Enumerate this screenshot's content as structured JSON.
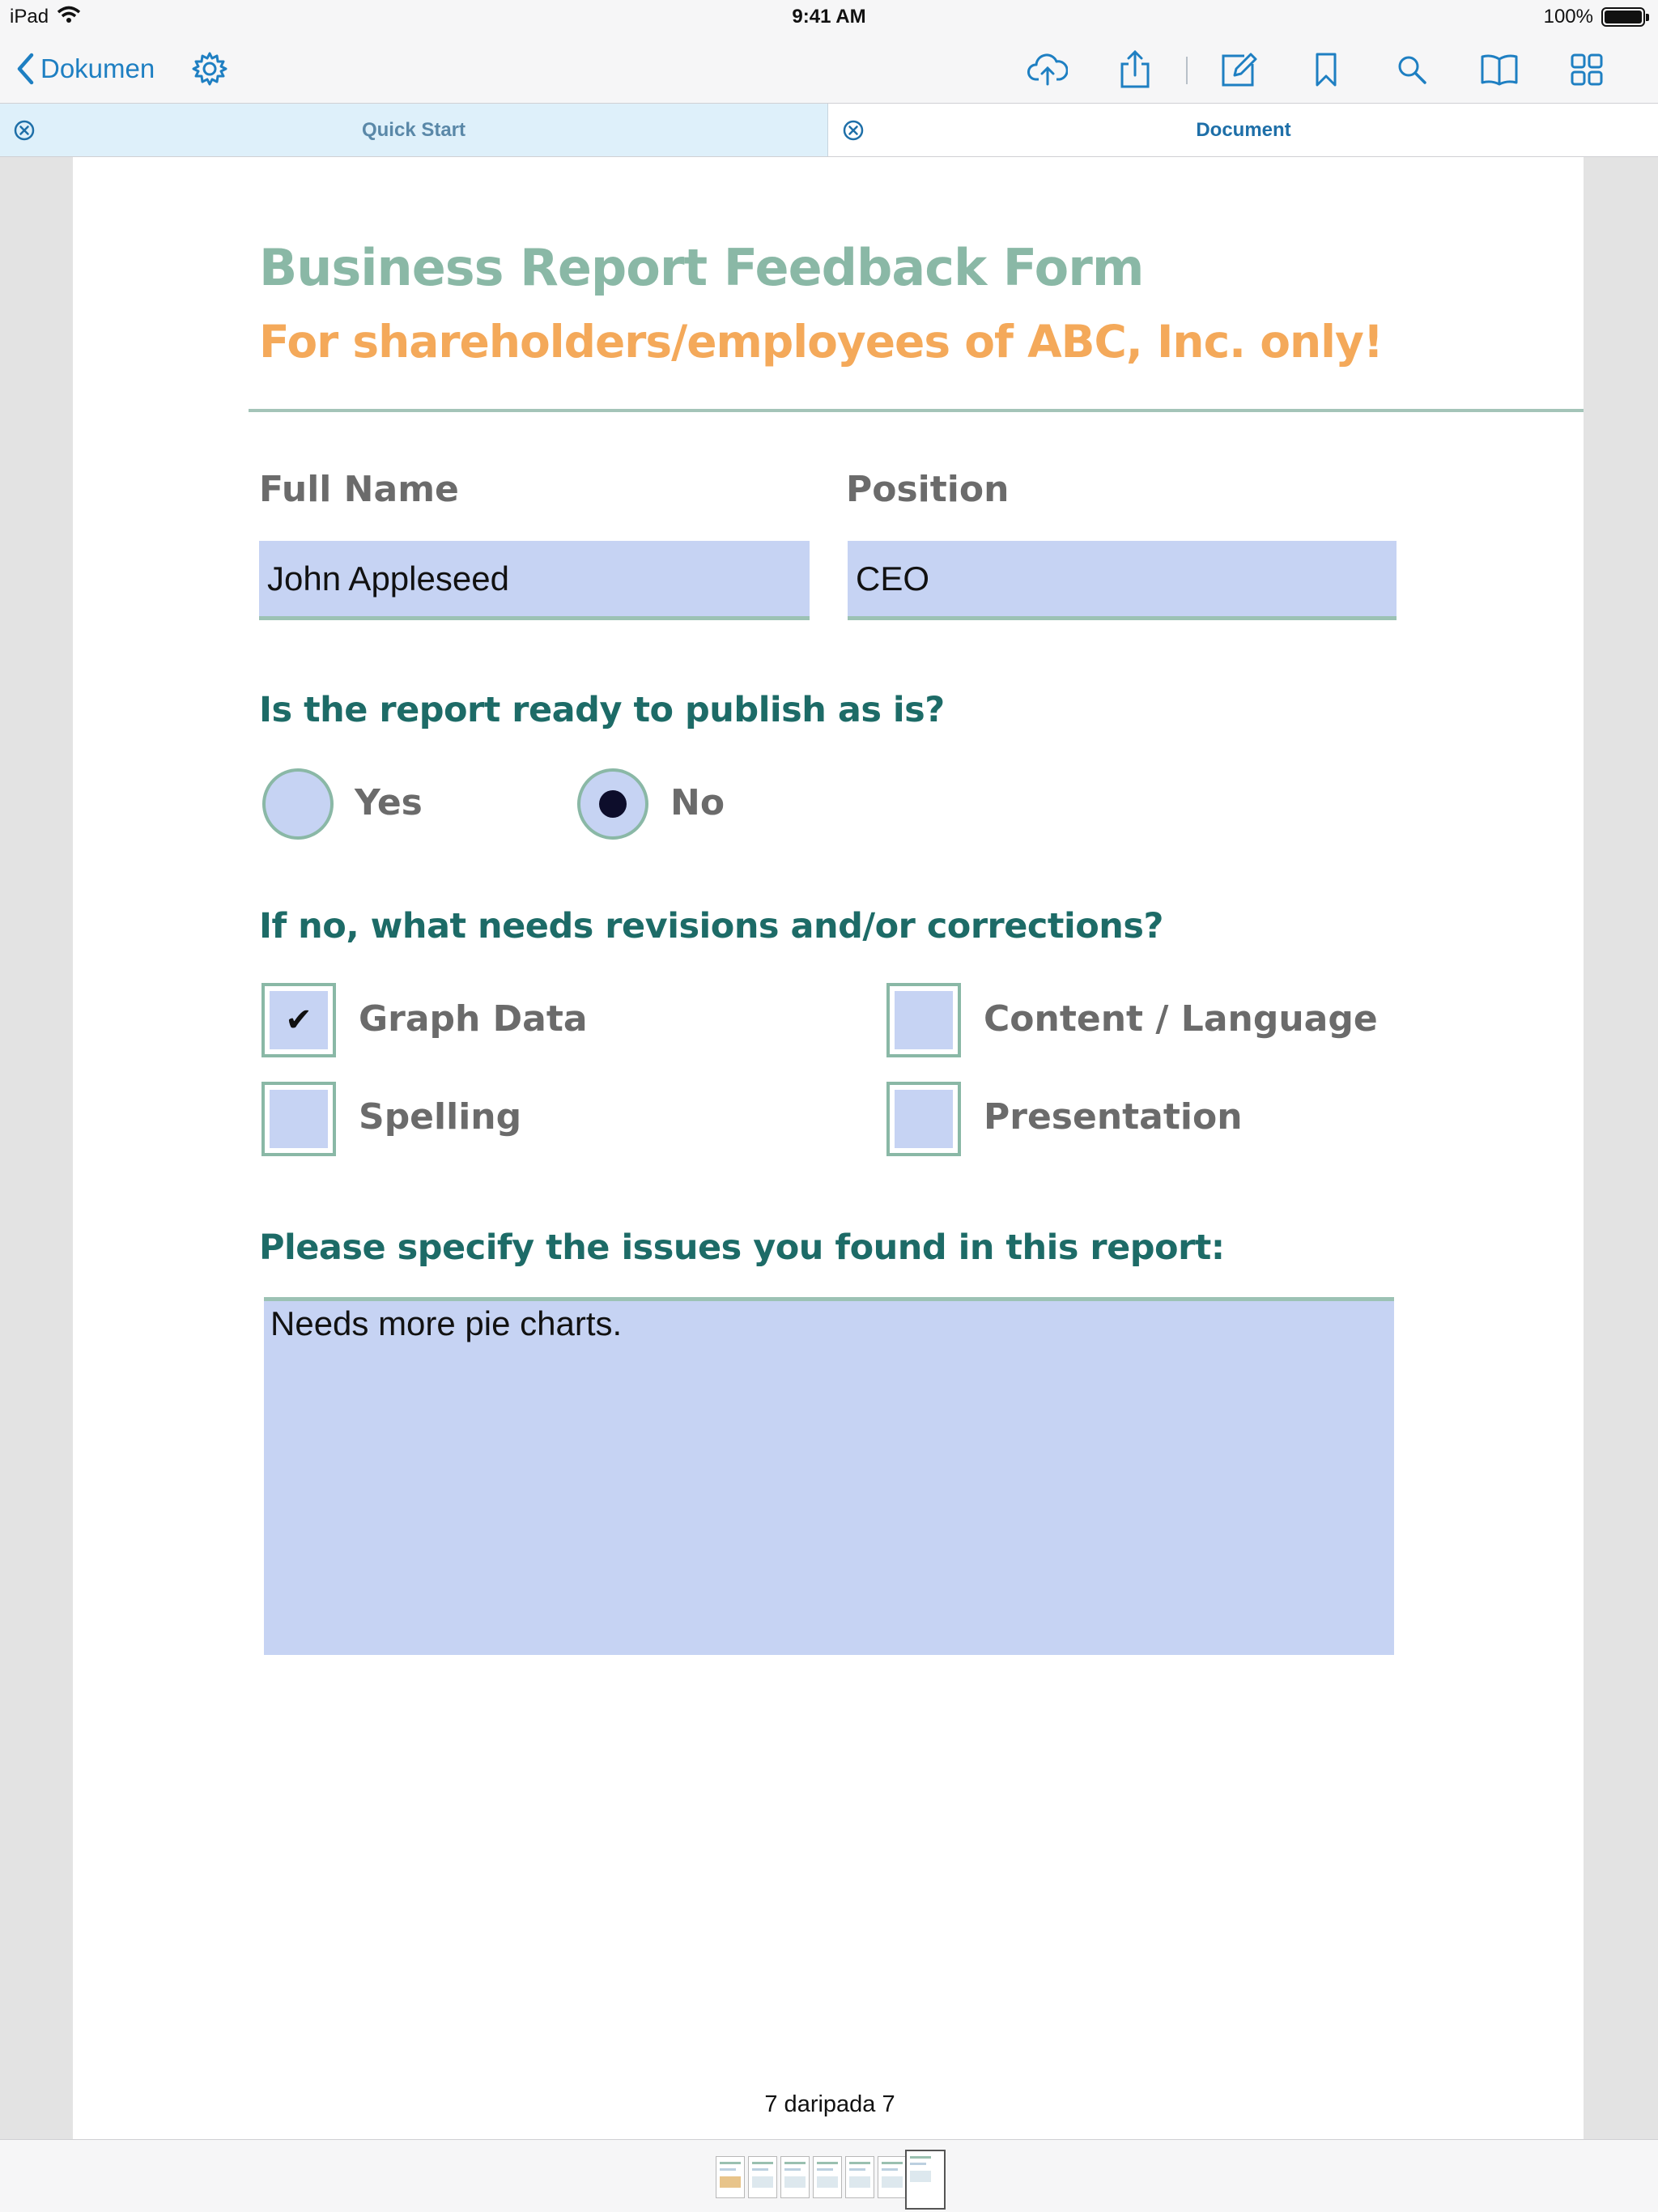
{
  "status_bar": {
    "device": "iPad",
    "time": "9:41 AM",
    "battery": "100%"
  },
  "nav": {
    "back_label": "Dokumen",
    "toolbar_icons": [
      "cloud-upload-icon",
      "share-icon",
      "edit-icon",
      "bookmark-icon",
      "search-icon",
      "book-icon",
      "grid-icon"
    ]
  },
  "tabs": [
    {
      "label": "Quick Start",
      "active": false
    },
    {
      "label": "Document",
      "active": true
    }
  ],
  "form": {
    "title": "Business Report Feedback Form",
    "subtitle": "For shareholders/employees of ABC, Inc. only!",
    "full_name": {
      "label": "Full Name",
      "value": "John Appleseed"
    },
    "position": {
      "label": "Position",
      "value": "CEO"
    },
    "publish_question": "Is the report ready to publish as is?",
    "publish_options": [
      {
        "label": "Yes",
        "selected": false
      },
      {
        "label": "No",
        "selected": true
      }
    ],
    "revisions_question": "If no, what needs revisions and/or corrections?",
    "revision_options": [
      {
        "label": "Graph Data",
        "checked": true,
        "mark": "✔"
      },
      {
        "label": "Content / Language",
        "checked": false
      },
      {
        "label": "Spelling",
        "checked": false
      },
      {
        "label": "Presentation",
        "checked": false
      }
    ],
    "issues_question": "Please specify the issues you found in this report:",
    "issues_value": "Needs more pie charts."
  },
  "page_indicator": "7 daripada 7",
  "colors": {
    "accent": "#1e7fc2",
    "title": "#8ab8a6",
    "subtitle": "#f4a95a",
    "question": "#1d6b67",
    "field_fill": "#c6d3f3"
  }
}
